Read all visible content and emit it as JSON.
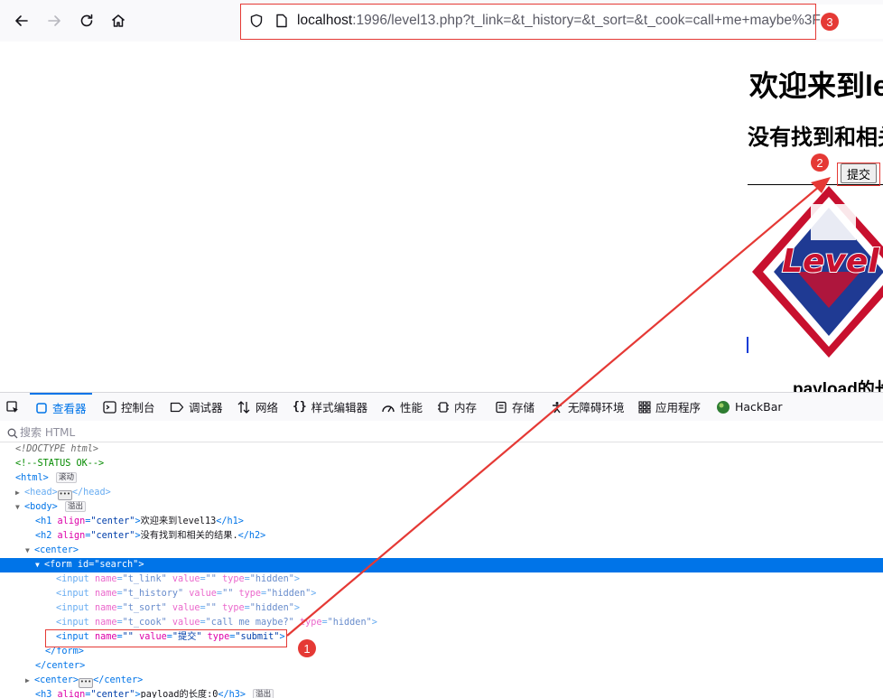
{
  "browser": {
    "url_host": "localhost",
    "url_rest": ":1996/level13.php?t_link=&t_history=&t_sort=&t_cook=call+me+maybe%3F"
  },
  "page": {
    "h1": "欢迎来到level13",
    "h2": "没有找到和相关的结果.",
    "submit_label": "提交",
    "logo_text": "Level",
    "h3": "payload的长度:0"
  },
  "annotations": {
    "badge1": "1",
    "badge2": "2",
    "badge3": "3",
    "color": "#e53935"
  },
  "devtools": {
    "tabs": [
      {
        "label": "查看器",
        "icon": "inspector-icon"
      },
      {
        "label": "控制台",
        "icon": "console-icon"
      },
      {
        "label": "调试器",
        "icon": "debugger-icon"
      },
      {
        "label": "网络",
        "icon": "network-icon"
      },
      {
        "label": "样式编辑器",
        "icon": "style-editor-icon"
      },
      {
        "label": "性能",
        "icon": "performance-icon"
      },
      {
        "label": "内存",
        "icon": "memory-icon"
      },
      {
        "label": "存储",
        "icon": "storage-icon"
      },
      {
        "label": "无障碍环境",
        "icon": "accessibility-icon"
      },
      {
        "label": "应用程序",
        "icon": "application-icon"
      },
      {
        "label": "HackBar",
        "icon": "hackbar-icon"
      }
    ],
    "search_placeholder": "搜索 HTML",
    "badge_scroll": "滚动",
    "badge_overflow": "溢出",
    "lines": {
      "doctype": "<!DOCTYPE html>",
      "comment": "<!--STATUS OK-->",
      "html": "<html>",
      "head_open": "<head>",
      "head_close": "</head>",
      "body": "<body>",
      "h1_tag": "<h1",
      "h1_attr": "align",
      "h1_val": "\"center\"",
      "h1_text": "欢迎来到level13",
      "h1_close": "</h1>",
      "h2_tag": "<h2",
      "h2_attr": "align",
      "h2_val": "\"center\"",
      "h2_text": "没有找到和相关的结果.",
      "h2_close": "</h2>",
      "center": "<center>",
      "form_tag": "<form",
      "form_attr": "id",
      "form_val": "\"search\"",
      "inputs": [
        {
          "name": "\"t_link\"",
          "value": "\"\"",
          "type": "\"hidden\""
        },
        {
          "name": "\"t_history\"",
          "value": "\"\"",
          "type": "\"hidden\""
        },
        {
          "name": "\"t_sort\"",
          "value": "\"\"",
          "type": "\"hidden\""
        },
        {
          "name": "\"t_cook\"",
          "value": "\"call me maybe?\"",
          "type": "\"hidden\""
        },
        {
          "name": "\"\"",
          "value": "\"提交\"",
          "type": "\"submit\""
        }
      ],
      "input_tag": "<input",
      "attr_name": "name",
      "attr_value": "value",
      "attr_type": "type",
      "form_close": "</form>",
      "center_close": "</center>",
      "center2_open": "<center>",
      "center2_close": "</center>",
      "h3_tag": "<h3",
      "h3_attr": "align",
      "h3_val": "\"center\"",
      "h3_text": "payload的长度:0",
      "h3_close": "</h3>"
    }
  }
}
